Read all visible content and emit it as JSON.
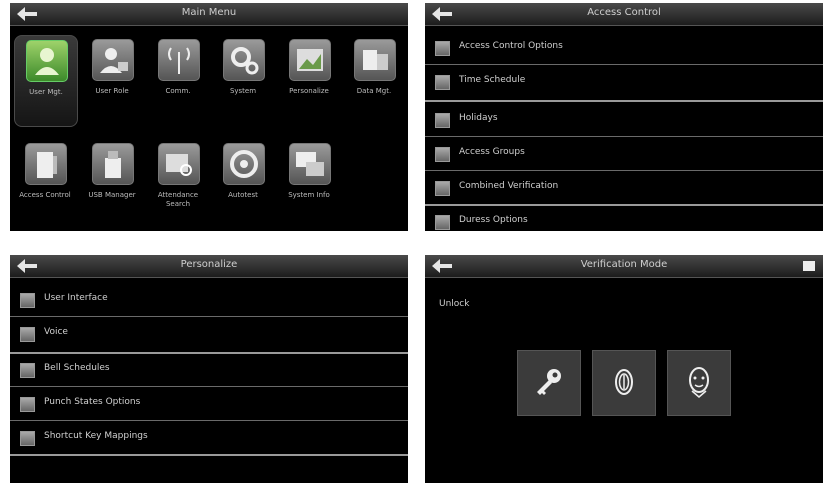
{
  "main_menu": {
    "title": "Main Menu",
    "tiles": [
      {
        "label": "User Mgt.",
        "icon": "user-management-icon",
        "selected": true
      },
      {
        "label": "User Role",
        "icon": "user-role-icon"
      },
      {
        "label": "Comm.",
        "icon": "communication-antenna-icon"
      },
      {
        "label": "System",
        "icon": "gear-icon"
      },
      {
        "label": "Personalize",
        "icon": "personalize-picture-icon"
      },
      {
        "label": "Data Mgt.",
        "icon": "data-management-icon"
      },
      {
        "label": "Access Control",
        "icon": "access-door-icon"
      },
      {
        "label": "USB Manager",
        "icon": "usb-drive-icon"
      },
      {
        "label": "Attendance Search",
        "icon": "attendance-search-icon"
      },
      {
        "label": "Autotest",
        "icon": "autotest-dial-icon"
      },
      {
        "label": "System Info",
        "icon": "system-info-monitor-icon"
      }
    ]
  },
  "access_control": {
    "title": "Access Control",
    "items": [
      {
        "label": "Access Control Options",
        "icon": "options-icon"
      },
      {
        "label": "Time Schedule",
        "icon": "clock-icon"
      },
      {
        "label": "Holidays",
        "icon": "holiday-calendar-icon"
      },
      {
        "label": "Access Groups",
        "icon": "groups-icon"
      },
      {
        "label": "Combined Verification",
        "icon": "combined-verify-icon"
      },
      {
        "label": "Duress Options",
        "icon": "duress-icon"
      }
    ]
  },
  "personalize": {
    "title": "Personalize",
    "items": [
      {
        "label": "User Interface",
        "icon": "interface-icon"
      },
      {
        "label": "Voice",
        "icon": "voice-icon"
      },
      {
        "label": "Bell Schedules",
        "icon": "bell-icon"
      },
      {
        "label": "Punch States Options",
        "icon": "punch-states-icon"
      },
      {
        "label": "Shortcut Key Mappings",
        "icon": "shortcut-key-icon"
      }
    ]
  },
  "verify_mode": {
    "title": "Verification Mode",
    "unlock_label": "Unlock",
    "methods": [
      {
        "icon": "key-icon"
      },
      {
        "icon": "fingerprint-icon"
      },
      {
        "icon": "face-icon"
      }
    ]
  },
  "colors": {
    "panel": "#000000",
    "titlebar": "#2e2e2e",
    "selected_tile": "#4caf50",
    "text": "#d0d0d0"
  }
}
